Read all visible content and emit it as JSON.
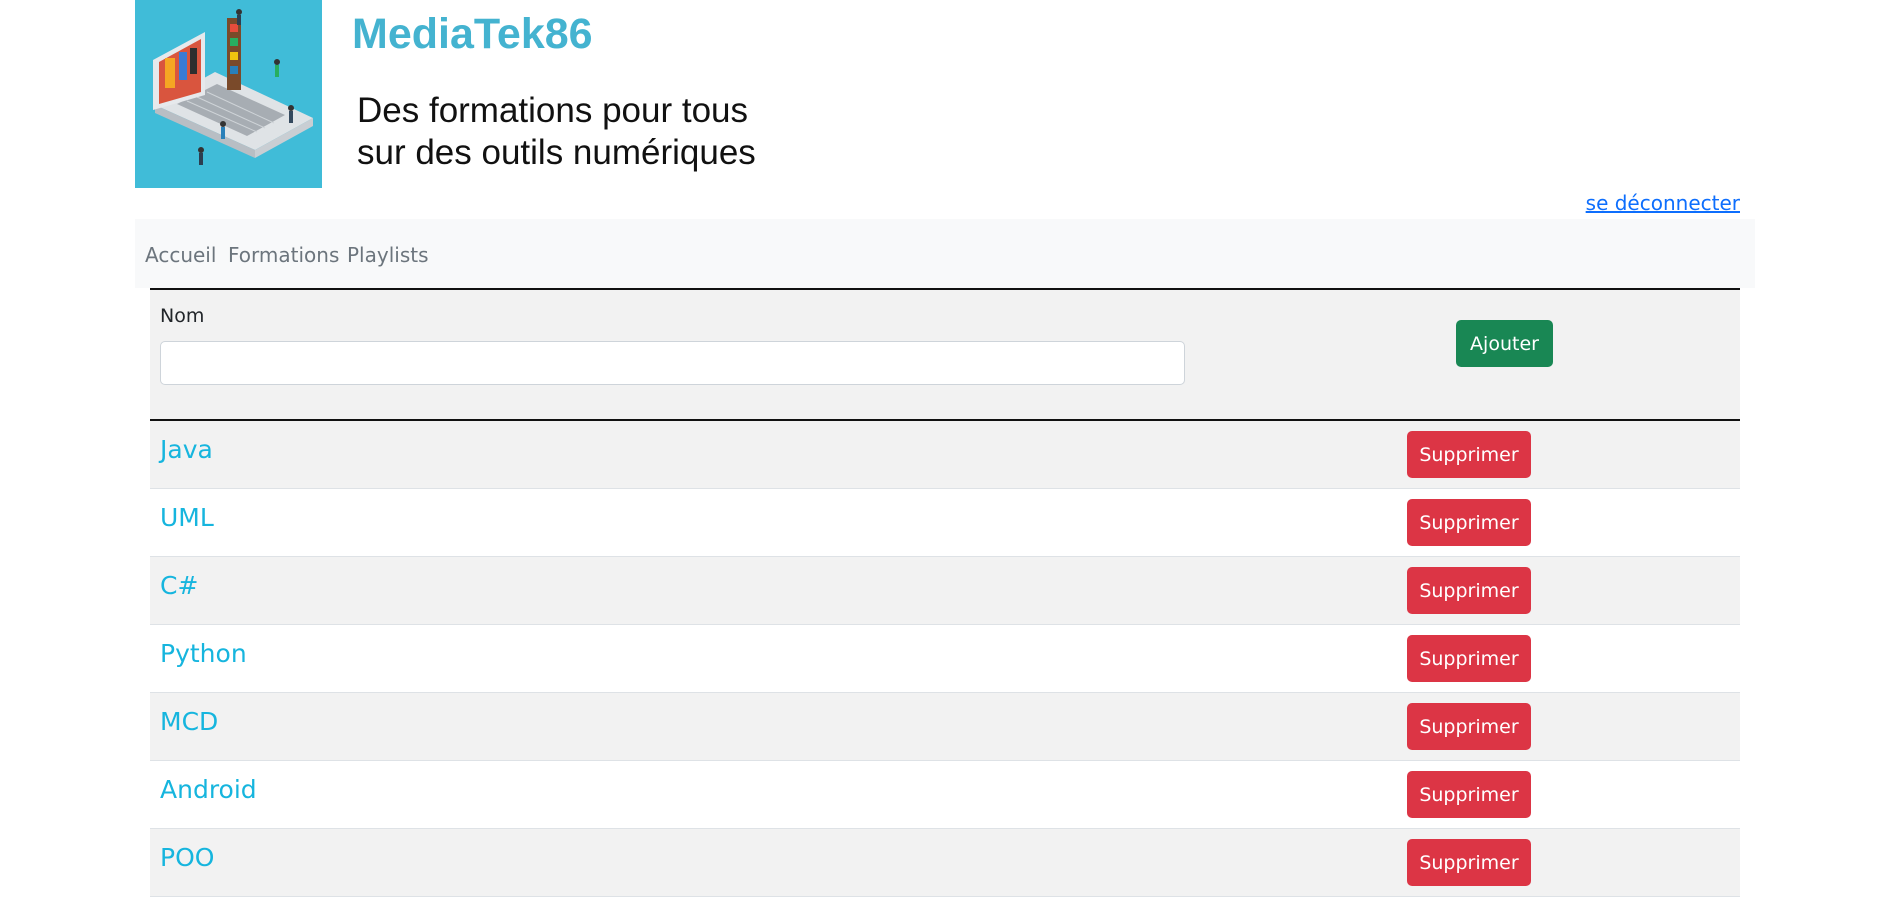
{
  "header": {
    "brand": "MediaTek86",
    "tagline_line1": "Des formations pour tous",
    "tagline_line2": "sur des outils numériques",
    "logout": "se déconnecter"
  },
  "nav": [
    {
      "label": "Accueil"
    },
    {
      "label": "Formations"
    },
    {
      "label": "Playlists"
    }
  ],
  "form": {
    "nom_label": "Nom",
    "nom_value": "",
    "add_button": "Ajouter"
  },
  "rows": [
    {
      "name": "Java",
      "delete": "Supprimer"
    },
    {
      "name": "UML",
      "delete": "Supprimer"
    },
    {
      "name": "C#",
      "delete": "Supprimer"
    },
    {
      "name": "Python",
      "delete": "Supprimer"
    },
    {
      "name": "MCD",
      "delete": "Supprimer"
    },
    {
      "name": "Android",
      "delete": "Supprimer"
    },
    {
      "name": "POO",
      "delete": "Supprimer"
    }
  ],
  "colors": {
    "brand": "#44b3d0",
    "logo_bg": "#40bcd8",
    "add_button": "#198754",
    "delete_button": "#dc3545",
    "row_link": "#16b5de"
  }
}
